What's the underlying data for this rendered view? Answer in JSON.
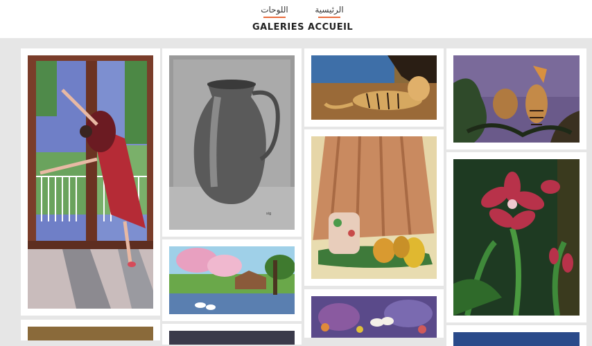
{
  "nav": [
    {
      "ar": "اللوحات",
      "fr": "GALERIES"
    },
    {
      "ar": "الرئيسية",
      "fr": "ACCUEIL"
    }
  ],
  "colors": {
    "accent": "#e86a3a",
    "page_bg": "#e6e6e6",
    "card_bg": "#ffffff"
  },
  "gallery": [
    "ballerina-painting",
    "pitcher-drawing",
    "tiger-painting",
    "hoopoe-birds-painting",
    "still-life-pears-painting",
    "landscape-cottage-painting",
    "amaryllis-flowers-painting",
    "doves-painting"
  ]
}
